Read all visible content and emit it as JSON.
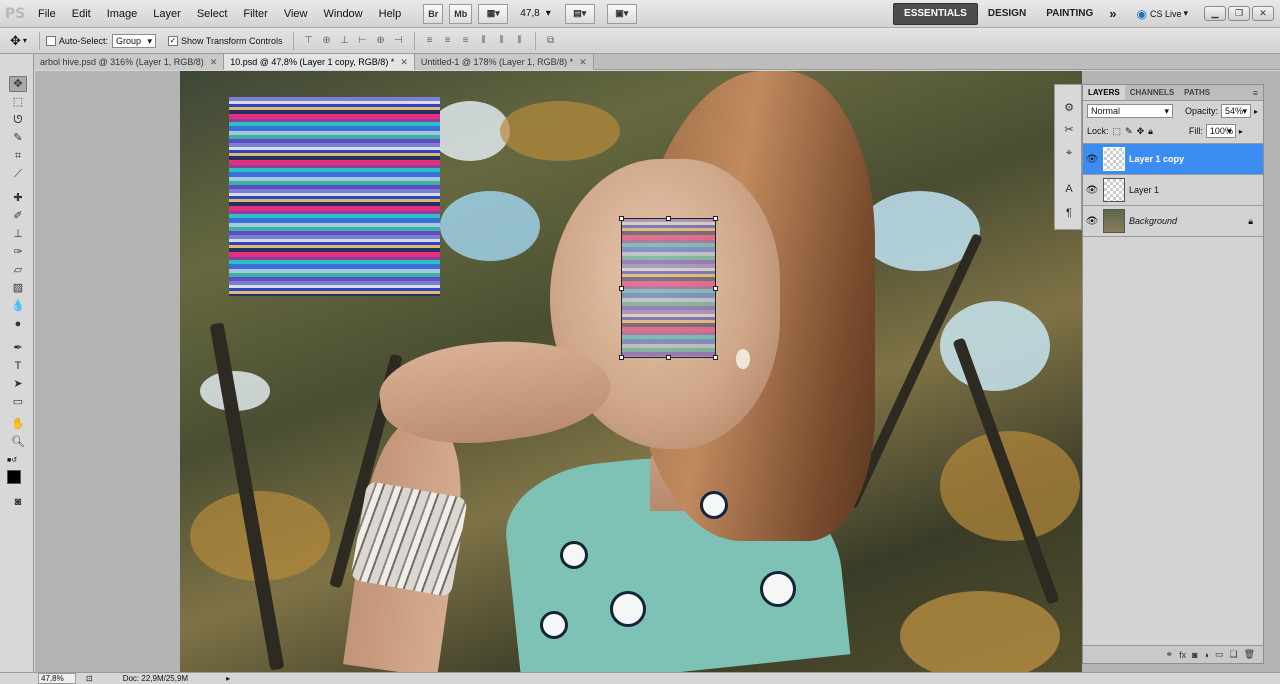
{
  "app": {
    "logo": "PS"
  },
  "menu": [
    "File",
    "Edit",
    "Image",
    "Layer",
    "Select",
    "Filter",
    "View",
    "Window",
    "Help"
  ],
  "appbar": {
    "bridge": "Br",
    "minibridge": "Mb",
    "zoom": "47,8",
    "workspaces": [
      "ESSENTIALS",
      "DESIGN",
      "PAINTING"
    ],
    "more": "»",
    "cslive": "CS Live"
  },
  "options": {
    "auto_select_label": "Auto-Select:",
    "auto_select_value": "Group",
    "show_transform_label": "Show Transform Controls",
    "auto_select_checked": false,
    "show_transform_checked": true
  },
  "tabs": [
    {
      "label": "arbol hive.psd @ 316% (Layer 1, RGB/8)",
      "active": false
    },
    {
      "label": "10.psd @ 47,8% (Layer 1 copy, RGB/8) *",
      "active": true
    },
    {
      "label": "Untitled-1 @ 178% (Layer 1, RGB/8) *",
      "active": false
    }
  ],
  "layers_panel": {
    "tabs": [
      "LAYERS",
      "CHANNELS",
      "PATHS"
    ],
    "blend_mode": "Normal",
    "opacity_label": "Opacity:",
    "opacity": "54%",
    "lock_label": "Lock:",
    "fill_label": "Fill:",
    "fill": "100%",
    "layers": [
      {
        "name": "Layer 1 copy",
        "selected": true,
        "locked": false
      },
      {
        "name": "Layer 1",
        "selected": false,
        "locked": false
      },
      {
        "name": "Background",
        "selected": false,
        "locked": true
      }
    ]
  },
  "status": {
    "zoom": "47,8%",
    "doc": "Doc: 22,9M/25,9M"
  },
  "colors": {
    "accent": "#3b8df3",
    "panel": "#d3d3d3",
    "active_workspace": "#4d4d4d"
  }
}
